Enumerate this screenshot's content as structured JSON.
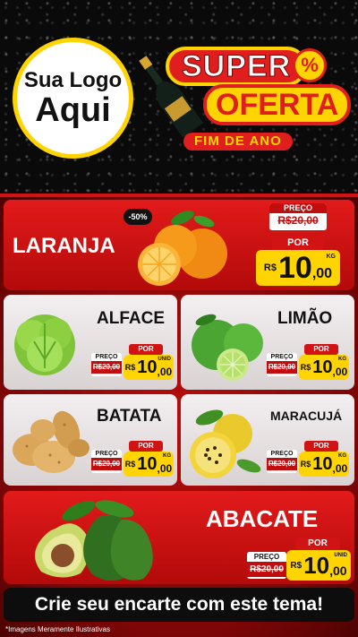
{
  "header": {
    "logo_line1": "Sua Logo",
    "logo_line2": "Aqui",
    "title_super": "SUPER",
    "percent_symbol": "%",
    "title_oferta": "OFERTA",
    "subtitle": "FIM DE ANO"
  },
  "colors": {
    "brand_red": "#e01e1e",
    "brand_yellow": "#ffd400",
    "dark": "#0b0b0b"
  },
  "products": [
    {
      "name": "LARANJA",
      "badge": "-50%",
      "preco_label": "PREÇO",
      "old_price": "R$20,00",
      "por_label": "POR",
      "currency": "R$",
      "price_int": "10",
      "price_cents": ",00",
      "unit": "KG",
      "icon": "orange-icon"
    },
    {
      "name": "ALFACE",
      "preco_label": "PREÇO",
      "old_price": "R$20,00",
      "por_label": "POR",
      "currency": "R$",
      "price_int": "10",
      "price_cents": ",00",
      "unit": "UNID",
      "icon": "lettuce-icon"
    },
    {
      "name": "LIMÃO",
      "preco_label": "PREÇO",
      "old_price": "R$20,00",
      "por_label": "POR",
      "currency": "R$",
      "price_int": "10",
      "price_cents": ",00",
      "unit": "KG",
      "icon": "lime-icon"
    },
    {
      "name": "BATATA",
      "preco_label": "PREÇO",
      "old_price": "R$20,00",
      "por_label": "POR",
      "currency": "R$",
      "price_int": "10",
      "price_cents": ",00",
      "unit": "KG",
      "icon": "potato-icon"
    },
    {
      "name": "MARACUJÁ",
      "preco_label": "PREÇO",
      "old_price": "R$20,00",
      "por_label": "POR",
      "currency": "R$",
      "price_int": "10",
      "price_cents": ",00",
      "unit": "KG",
      "icon": "passion-fruit-icon"
    },
    {
      "name": "ABACATE",
      "preco_label": "PREÇO",
      "old_price": "R$20,00",
      "por_label": "POR",
      "currency": "R$",
      "price_int": "10",
      "price_cents": ",00",
      "unit": "UNID",
      "icon": "avocado-icon"
    }
  ],
  "cta": "Crie seu encarte com este tema!",
  "disclaimer": "*Imagens Meramente Ilustrativas"
}
